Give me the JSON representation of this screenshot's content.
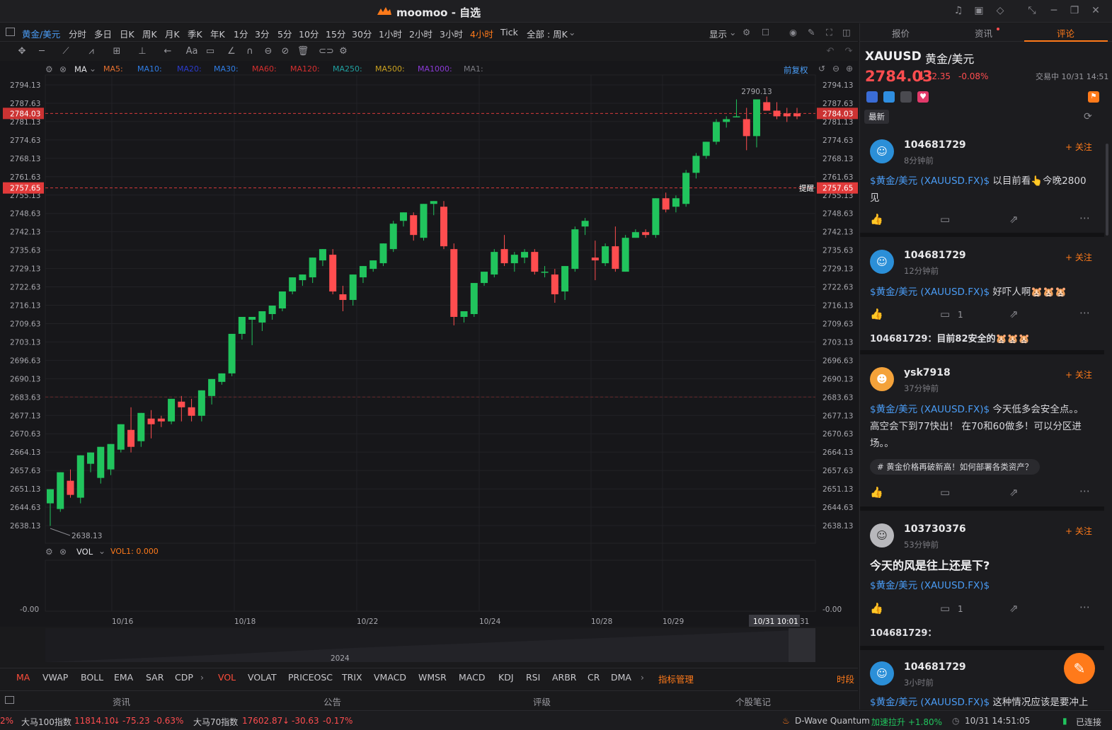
{
  "app": {
    "title": "moomoo - 自选"
  },
  "periods": {
    "symbol": "黄金/美元",
    "items": [
      "分时",
      "多日",
      "日K",
      "周K",
      "月K",
      "季K",
      "年K",
      "1分",
      "3分",
      "5分",
      "10分",
      "15分",
      "30分",
      "1小时",
      "2小时",
      "3小时",
      "4小时",
      "Tick"
    ],
    "active": "4小时",
    "range": "全部 : 周K",
    "display": "显示"
  },
  "ma_legend": {
    "label": "MA",
    "items": [
      {
        "text": "MA5:",
        "color": "#e6702f"
      },
      {
        "text": "MA10:",
        "color": "#2f7de6"
      },
      {
        "text": "MA20:",
        "color": "#2b3bcc"
      },
      {
        "text": "MA30:",
        "color": "#2f7de6"
      },
      {
        "text": "MA60:",
        "color": "#d62f2f"
      },
      {
        "text": "MA120:",
        "color": "#d62f2f"
      },
      {
        "text": "MA250:",
        "color": "#20a0a0"
      },
      {
        "text": "MA500:",
        "color": "#c8a020"
      },
      {
        "text": "MA1000:",
        "color": "#8a3ad6"
      },
      {
        "text": "MA1:",
        "color": "#7a7a80"
      }
    ],
    "adjust": "前复权"
  },
  "vol_legend": {
    "label": "VOL",
    "value": "VOL1:  0.000"
  },
  "price_axis": [
    "2794.13",
    "2787.63",
    "2781.13",
    "2774.63",
    "2768.13",
    "2761.63",
    "2755.13",
    "2748.63",
    "2742.13",
    "2735.63",
    "2729.13",
    "2722.63",
    "2716.13",
    "2709.63",
    "2703.13",
    "2696.63",
    "2690.13",
    "2683.63",
    "2677.13",
    "2670.63",
    "2664.13",
    "2657.63",
    "2651.13",
    "2644.63",
    "2638.13"
  ],
  "vol_axis": "-0.00",
  "markers": {
    "current": "2784.03",
    "alert": "2757.65",
    "alert_label": "提醒",
    "high": "2790.13",
    "low": "2638.13"
  },
  "date_axis": [
    "10/16",
    "10/18",
    "10/22",
    "10/24",
    "10/28",
    "10/29"
  ],
  "crosshair_date": "10/31 10:01",
  "crosshair_date_tail": "31",
  "navigator_year": "2024",
  "chart_data": {
    "type": "candlestick",
    "instrument": "XAUUSD 黄金/美元",
    "interval": "4小时",
    "ylim": [
      2638.13,
      2794.13
    ],
    "candles": [
      [
        2646,
        2651,
        2638,
        2647
      ],
      [
        2644,
        2657,
        2643,
        2655
      ],
      [
        2654,
        2649,
        2658,
        2648
      ],
      [
        2648,
        2663,
        2646,
        2660
      ],
      [
        2660,
        2664,
        2657,
        2661
      ],
      [
        2655,
        2666,
        2653,
        2665
      ],
      [
        2658,
        2667,
        2656,
        2665
      ],
      [
        2665,
        2674,
        2664,
        2672
      ],
      [
        2672,
        2666,
        2680,
        2664
      ],
      [
        2668,
        2678,
        2666,
        2676
      ],
      [
        2676,
        2674,
        2679,
        2669
      ],
      [
        2676,
        2675,
        2677,
        2673
      ],
      [
        2675,
        2683,
        2674,
        2682
      ],
      [
        2682,
        2680,
        2684,
        2675
      ],
      [
        2680,
        2677,
        2683,
        2675
      ],
      [
        2677,
        2686,
        2675,
        2684
      ],
      [
        2684,
        2690,
        2681,
        2689
      ],
      [
        2689,
        2692,
        2688,
        2692
      ],
      [
        2692,
        2706,
        2691,
        2705
      ],
      [
        2706,
        2712,
        2704,
        2711
      ],
      [
        2711,
        2712,
        2702,
        2712
      ],
      [
        2710,
        2714,
        2707,
        2713
      ],
      [
        2713,
        2716,
        2711,
        2715
      ],
      [
        2715,
        2721,
        2714,
        2721
      ],
      [
        2721,
        2726,
        2720,
        2725
      ],
      [
        2725,
        2727,
        2723,
        2726
      ],
      [
        2726,
        2733,
        2724,
        2732
      ],
      [
        2732,
        2736,
        2730,
        2734
      ],
      [
        2734,
        2721,
        2736,
        2720
      ],
      [
        2720,
        2718,
        2723,
        2714
      ],
      [
        2718,
        2727,
        2716,
        2726
      ],
      [
        2726,
        2730,
        2724,
        2729
      ],
      [
        2729,
        2732,
        2728,
        2731
      ],
      [
        2731,
        2738,
        2730,
        2736
      ],
      [
        2736,
        2745,
        2735,
        2746
      ],
      [
        2746,
        2749,
        2744,
        2748
      ],
      [
        2748,
        2741,
        2749,
        2739
      ],
      [
        2740,
        2752,
        2739,
        2752
      ],
      [
        2752,
        2753,
        2748,
        2751
      ],
      [
        2751,
        2737,
        2753,
        2736
      ],
      [
        2736,
        2712,
        2738,
        2709
      ],
      [
        2712,
        2714,
        2710,
        2713
      ],
      [
        2713,
        2724,
        2712,
        2724
      ],
      [
        2724,
        2728,
        2723,
        2727
      ],
      [
        2727,
        2735,
        2726,
        2736
      ],
      [
        2736,
        2731,
        2741,
        2730
      ],
      [
        2731,
        2734,
        2728,
        2735
      ],
      [
        2733,
        2735,
        2731,
        2736
      ],
      [
        2735,
        2728,
        2736,
        2727
      ],
      [
        2728,
        2728,
        2730,
        2726
      ],
      [
        2727,
        2720,
        2729,
        2717
      ],
      [
        2721,
        2730,
        2718,
        2729
      ],
      [
        2729,
        2743,
        2728,
        2744
      ],
      [
        2744,
        2746,
        2741,
        2747
      ],
      [
        2733,
        2732,
        2739,
        2725
      ],
      [
        2731,
        2737,
        2730,
        2738
      ],
      [
        2737,
        2729,
        2744,
        2728
      ],
      [
        2728,
        2740,
        2728,
        2741
      ],
      [
        2740,
        2742,
        2740,
        2743
      ],
      [
        2742,
        2741,
        2743,
        2740
      ],
      [
        2741,
        2754,
        2740,
        2754
      ],
      [
        2754,
        2750,
        2756,
        2749
      ],
      [
        2751,
        2754,
        2749,
        2755
      ],
      [
        2752,
        2763,
        2751,
        2764
      ],
      [
        2763,
        2769,
        2761,
        2770
      ],
      [
        2769,
        2774,
        2768,
        2774
      ],
      [
        2774,
        2781,
        2773,
        2782
      ],
      [
        2781,
        2782,
        2779,
        2783
      ],
      [
        2783,
        2783,
        2783,
        2789
      ],
      [
        2782,
        2776,
        2786,
        2771
      ],
      [
        2776,
        2789,
        2772,
        2788
      ],
      [
        2788,
        2785,
        2790,
        2785
      ],
      [
        2785,
        2783,
        2788,
        2782
      ],
      [
        2784,
        2783,
        2786,
        2781
      ],
      [
        2784,
        2783,
        2786,
        2782
      ]
    ]
  },
  "right_panel": {
    "tabs": [
      "报价",
      "资讯",
      "评论"
    ],
    "active_tab": "评论",
    "symbol": "XAUUSD",
    "name": "黄金/美元",
    "price": "2784.03",
    "arrow": "↓",
    "change": "-2.35",
    "change_pct": "-0.08%",
    "status": "交易中 10/31 14:51",
    "filter": "最新",
    "follow": "+ 关注",
    "posts": [
      {
        "user": "104681729",
        "time": "8分钟前",
        "tag": "$黄金/美元 (XAUUSD.FX)$",
        "text": " 以目前看👆今晚2800见",
        "comments": "",
        "reply": ""
      },
      {
        "user": "104681729",
        "time": "12分钟前",
        "tag": "$黄金/美元 (XAUUSD.FX)$",
        "text": " 好吓人啊🐹🐹🐹",
        "comments": "1",
        "reply": "104681729：目前82安全的🐹🐹🐹"
      },
      {
        "user": "ysk7918",
        "time": "37分钟前",
        "tag": "$黄金/美元 (XAUUSD.FX)$",
        "text": " 今天低多会安全点。。高空会下到77快出！ 在70和60做多！可以分区进场。。",
        "topic": "# 黄金价格再破新高！如何部署各类资产？",
        "comments": "",
        "reply": ""
      },
      {
        "user": "103730376",
        "time": "53分钟前",
        "title": "今天的风是往上还是下?",
        "tag": "$黄金/美元 (XAUUSD.FX)$",
        "text": "",
        "comments": "1",
        "reply": "104681729："
      },
      {
        "user": "104681729",
        "time": "3小时前",
        "tag": "$黄金/美元 (XAUUSD.FX)$",
        "text": " 这种情况应该是要冲上",
        "comments": "",
        "reply": ""
      }
    ]
  },
  "indicators": {
    "items": [
      "MA",
      "VWAP",
      "BOLL",
      "EMA",
      "SAR",
      "CDP",
      "VOL",
      "VOLAT",
      "PRICEOSC",
      "TRIX",
      "VMACD",
      "WMSR",
      "MACD",
      "KDJ",
      "RSI",
      "ARBR",
      "CR",
      "DMA"
    ],
    "active": [
      "MA",
      "VOL"
    ],
    "manage": "指标管理",
    "right": "时段"
  },
  "bottom_tabs": [
    "资讯",
    "公告",
    "评级",
    "个股笔记"
  ],
  "status": {
    "left_pct": "2%",
    "idx1_name": "大马100指数",
    "idx1_val": "11814.10",
    "idx1_chg": "-75.23",
    "idx1_pct": "-0.63%",
    "idx2_name": "大马70指数",
    "idx2_val": "17602.87",
    "idx2_chg": "-30.63",
    "idx2_pct": "-0.17%",
    "news_name": "D-Wave Quantum",
    "news_text": "加速拉升 +1.80%",
    "clock": "10/31 14:51:05",
    "conn": "已连接"
  },
  "colors": {
    "up": "#21c45d",
    "down": "#ff4d4f",
    "accent": "#ff7a1a",
    "link": "#4a9cf5"
  }
}
